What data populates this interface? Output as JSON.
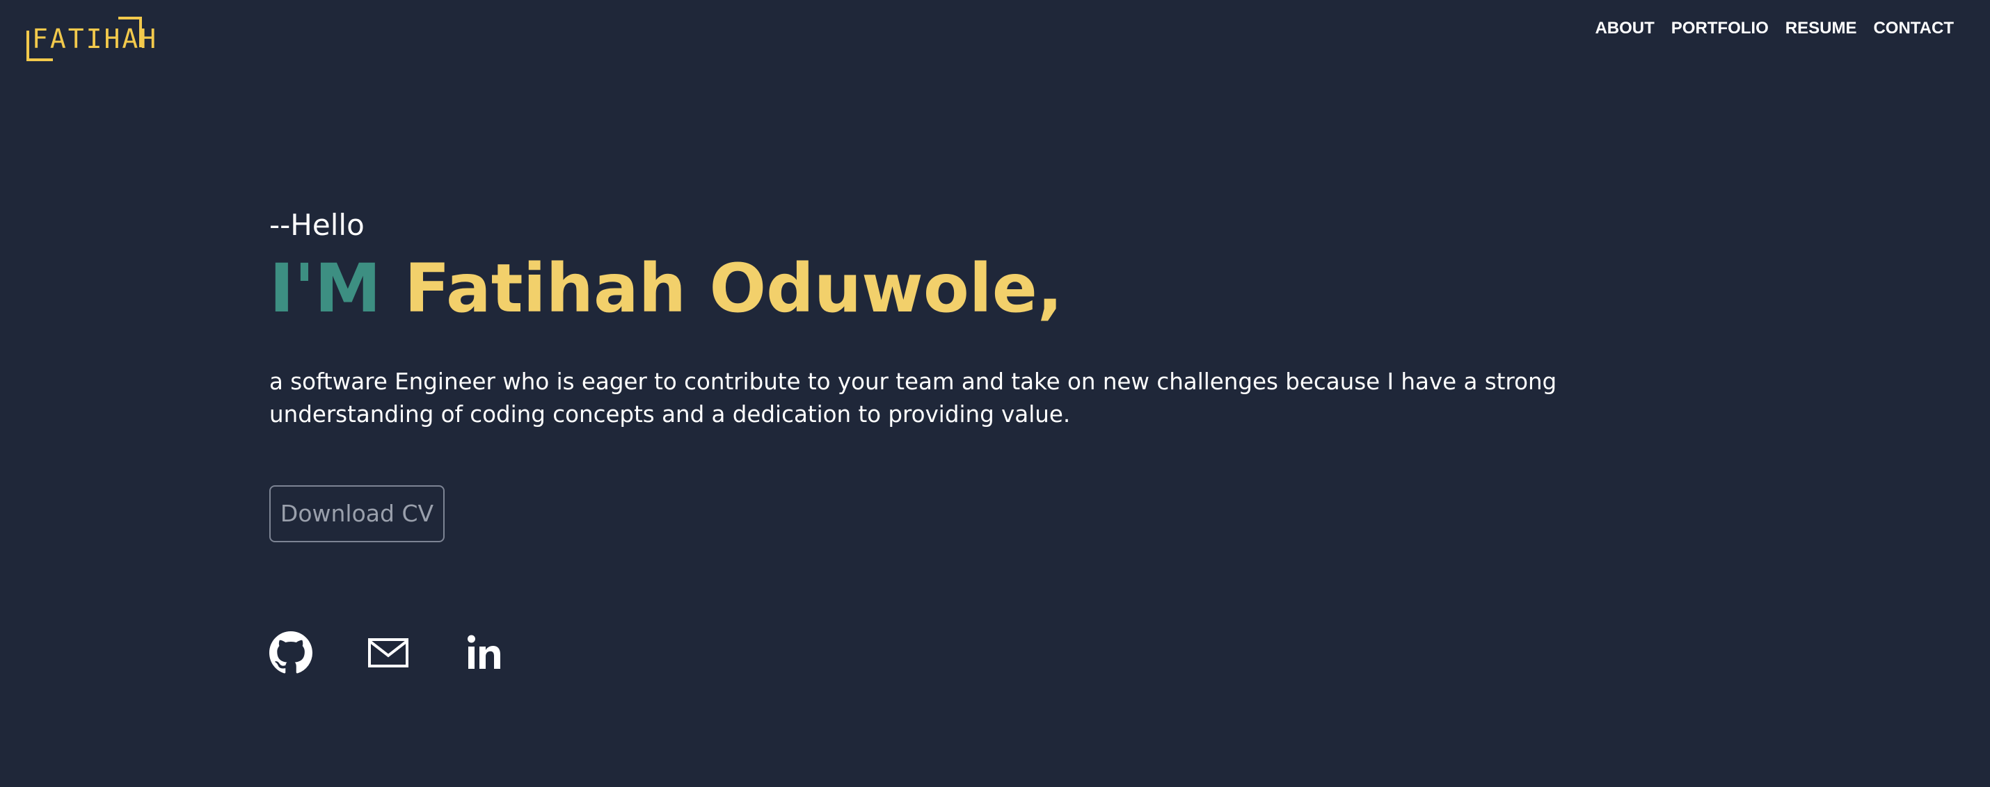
{
  "header": {
    "logo_text": "FATIHAH",
    "nav": [
      {
        "label": "ABOUT"
      },
      {
        "label": "PORTFOLIO"
      },
      {
        "label": "RESUME"
      },
      {
        "label": "CONTACT"
      }
    ]
  },
  "hero": {
    "greeting": "--Hello",
    "im_label": "I'M",
    "name": "Fatihah Oduwole,",
    "tagline": "a software Engineer who is eager to contribute to your team and take on new challenges because I have a strong understanding of coding concepts and a dedication to providing value.",
    "download_label": "Download CV"
  },
  "socials": [
    {
      "icon": "github-icon"
    },
    {
      "icon": "mail-icon"
    },
    {
      "icon": "linkedin-icon"
    }
  ],
  "colors": {
    "background": "#1f2739",
    "accent_yellow": "#f2d06b",
    "accent_teal": "#3d8f82",
    "text": "#ffffff"
  }
}
